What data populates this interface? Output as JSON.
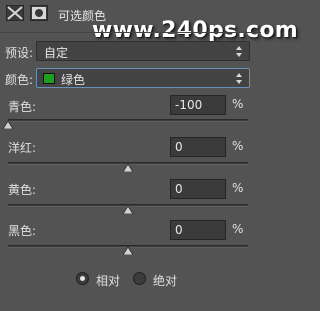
{
  "panel": {
    "title": "可选颜色",
    "watermark": "www.240ps.com"
  },
  "preset": {
    "label": "预设:",
    "value": "自定"
  },
  "colors": {
    "label": "颜色:",
    "value": "绿色",
    "swatch_color": "#1f9e1f"
  },
  "sliders": [
    {
      "label": "青色:",
      "value": "-100",
      "unit": "%",
      "level": -100
    },
    {
      "label": "洋红:",
      "value": "0",
      "unit": "%",
      "level": 0
    },
    {
      "label": "黄色:",
      "value": "0",
      "unit": "%",
      "level": 0
    },
    {
      "label": "黑色:",
      "value": "0",
      "unit": "%",
      "level": 0
    }
  ],
  "method": {
    "options": [
      {
        "label": "相对",
        "selected": true
      },
      {
        "label": "绝对",
        "selected": false
      }
    ]
  }
}
